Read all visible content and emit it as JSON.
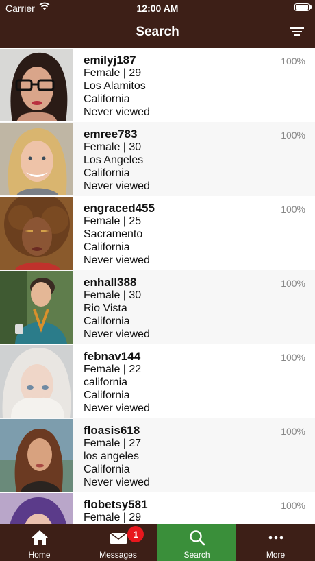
{
  "status_bar": {
    "carrier": "Carrier",
    "time": "12:00 AM"
  },
  "nav": {
    "title": "Search"
  },
  "results": [
    {
      "username": "emilyj187",
      "gender_age": "Female | 29",
      "city": "Los Alamitos",
      "state": "California",
      "viewed": "Never viewed",
      "match": "100%"
    },
    {
      "username": "emree783",
      "gender_age": "Female | 30",
      "city": "Los Angeles",
      "state": "California",
      "viewed": "Never viewed",
      "match": "100%"
    },
    {
      "username": "engraced455",
      "gender_age": "Female | 25",
      "city": "Sacramento",
      "state": "California",
      "viewed": "Never viewed",
      "match": "100%"
    },
    {
      "username": "enhall388",
      "gender_age": "Female | 30",
      "city": "Rio Vista",
      "state": "California",
      "viewed": "Never viewed",
      "match": "100%"
    },
    {
      "username": "febnav144",
      "gender_age": "Female | 22",
      "city": "california",
      "state": "California",
      "viewed": "Never viewed",
      "match": "100%"
    },
    {
      "username": "floasis618",
      "gender_age": "Female | 27",
      "city": "los angeles",
      "state": "California",
      "viewed": "Never viewed",
      "match": "100%"
    },
    {
      "username": "flobetsy581",
      "gender_age": "Female | 29",
      "city": "",
      "state": "",
      "viewed": "",
      "match": "100%"
    }
  ],
  "tabs": [
    {
      "label": "Home",
      "icon": "home-icon"
    },
    {
      "label": "Messages",
      "icon": "envelope-icon",
      "badge": "1"
    },
    {
      "label": "Search",
      "icon": "search-icon"
    },
    {
      "label": "More",
      "icon": "more-icon"
    }
  ],
  "colors": {
    "header_bg": "#3d1f17",
    "active_tab": "#3a8f3a",
    "badge": "#e8171d"
  }
}
